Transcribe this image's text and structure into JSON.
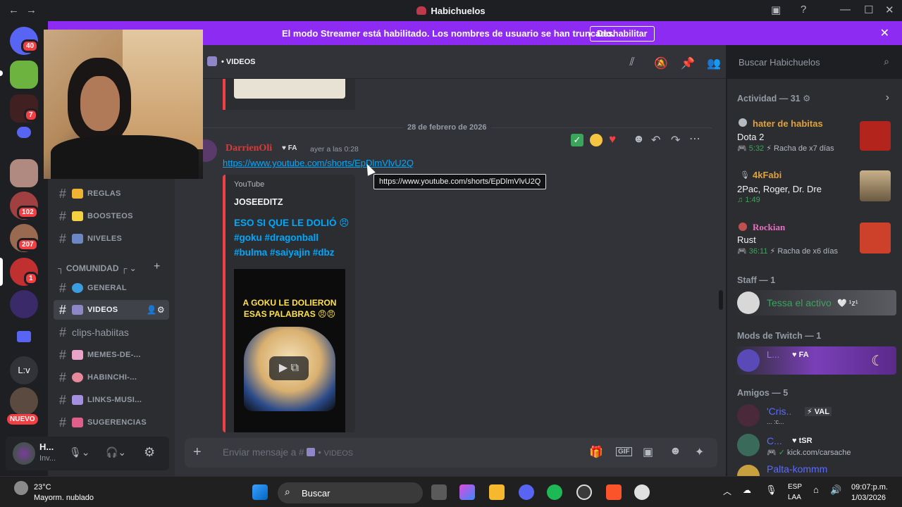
{
  "titlebar": {
    "title": "Habichuelos"
  },
  "banner": {
    "text": "El modo Streamer está habilitado. Los nombres de usuario se han truncado.",
    "button": "Deshabilitar"
  },
  "rail": {
    "badges": [
      "40",
      "7",
      "102",
      "207",
      "1"
    ],
    "label_lv": "L:v",
    "new_label": "NUEVO"
  },
  "channel_header": {
    "name": "VIDEOS"
  },
  "search": {
    "placeholder": "Buscar Habichuelos"
  },
  "sidebar": {
    "channels_top": [
      {
        "label": "REGLAS",
        "color": "#f0b232"
      },
      {
        "label": "BOOSTEOS",
        "color": "#f5d142"
      },
      {
        "label": "NIVELES",
        "color": "#6b88c4"
      }
    ],
    "category": "COMUNIDAD",
    "channels": [
      {
        "label": "GENERAL",
        "color": "#3b9de0"
      },
      {
        "label": "VIDEOS",
        "color": "#8f86c8"
      },
      {
        "label": "clips-habiitas",
        "color": ""
      },
      {
        "label": "MEMES-DE-...",
        "color": "#e9a3c9"
      },
      {
        "label": "HABINCHI-...",
        "color": "#e8899b"
      },
      {
        "label": "LINKS-MUSI...",
        "color": "#a48ee0"
      },
      {
        "label": "SUGERENCIAS",
        "color": "#e05f8a"
      }
    ],
    "user": {
      "name": "H...",
      "status": "Inv..."
    }
  },
  "chat": {
    "date_divider": "28 de febrero de 2026",
    "message": {
      "author": "DarrienOli",
      "tag": "FA",
      "time": "ayer a las 0:28",
      "link": "https://www.youtube.com/shorts/EpDlmVlvU2Q",
      "tooltip": "https://www.youtube.com/shorts/EpDlmVlvU2Q",
      "embed": {
        "provider": "YouTube",
        "author": "JOSEEDITZ",
        "title": "ESO SI QUE LE DOLIÓ 😠#goku #dragonball #bulma #saiyajin #dbz",
        "thumb_caption": "A GOKU LE DOLIERON ESAS PALABRAS 😠😠"
      }
    },
    "composer_placeholder": "Enviar mensaje a #",
    "composer_channel": "VIDEOS"
  },
  "members": {
    "activity_header": "Actividad — 31",
    "activities": [
      {
        "name": "hater de habitas",
        "game": "Dota 2",
        "time": "5:32",
        "streak": "Racha de x7 días",
        "name_color": "#e0a13b",
        "thumb": "#b3241c"
      },
      {
        "name": "4kFabi",
        "game": "2Pac, Roger, Dr. Dre",
        "time": "1:49",
        "streak": "",
        "name_color": "#e0a13b",
        "thumb": "#6b5a40"
      },
      {
        "name": "Rockian",
        "game": "Rust",
        "time": "36:11",
        "streak": "Racha de x6 días",
        "name_color": "#e86fc1",
        "thumb": "#cd412b"
      }
    ],
    "staff_header": "Staff — 1",
    "staff": [
      {
        "name": "Tessa el activo",
        "extra": "🤍 ¹z¹"
      }
    ],
    "mods_header": "Mods de Twitch — 1",
    "mods": [
      {
        "name": "L...",
        "tag": "FA"
      }
    ],
    "friends_header": "Amigos — 5",
    "friends": [
      {
        "name": "'Cris..",
        "tag": "VAL",
        "sub": "... :c..."
      },
      {
        "name": "C...",
        "tag": "tSR",
        "sub": "kick.com/carsache"
      },
      {
        "name": "Palta-kommm",
        "tag": "",
        "sub": ""
      }
    ]
  },
  "taskbar": {
    "weather_temp": "23°C",
    "weather_desc": "Mayorm. nublado",
    "search": "Buscar",
    "lang1": "ESP",
    "lang2": "LAA",
    "time": "09:07:p.m.",
    "date": "1/03/2026"
  }
}
